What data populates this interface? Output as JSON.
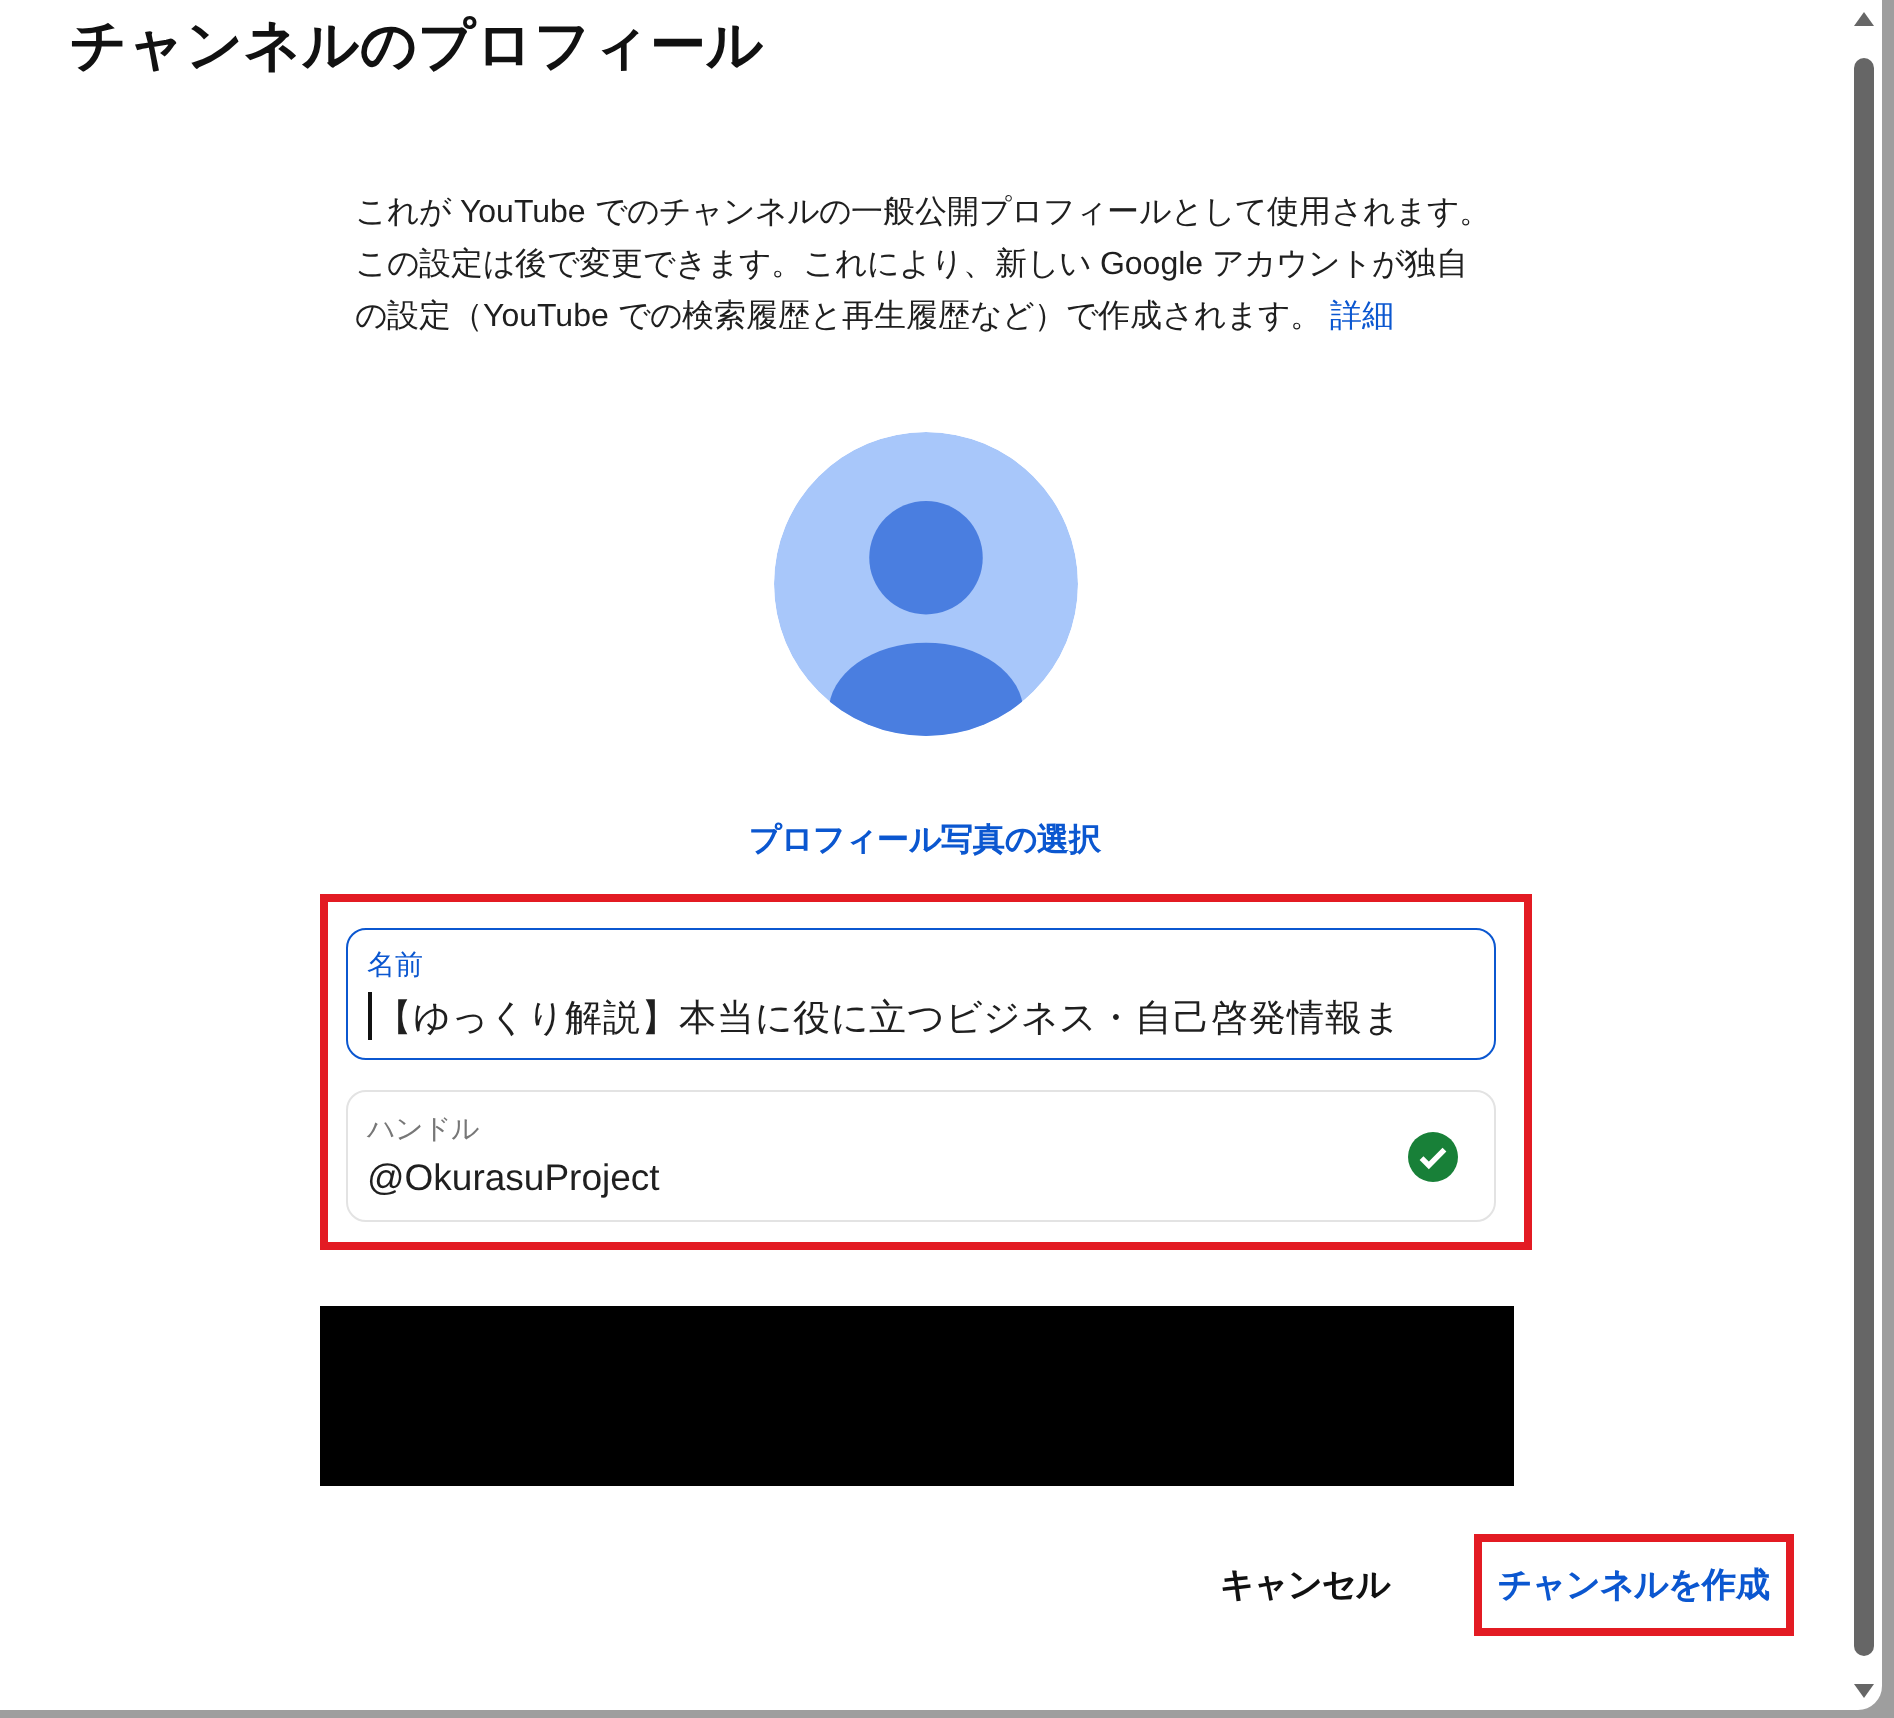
{
  "dialog": {
    "title": "チャンネルのプロフィール"
  },
  "description": {
    "text": "これが YouTube でのチャンネルの一般公開プロフィールとして使用されます。この設定は後で変更できます。これにより、新しい Google アカウントが独自の設定（YouTube での検索履歴と再生履歴など）で作成されます。",
    "link": "詳細"
  },
  "photo_link": "プロフィール写真の選択",
  "fields": [
    {
      "label": "名前",
      "value": "【ゆっくり解説】本当に役に立つビジネス・自己啓発情報ま",
      "focused": true,
      "verified": false
    },
    {
      "label": "ハンドル",
      "value": "@OkurasuProject",
      "focused": false,
      "verified": true
    }
  ],
  "buttons": [
    {
      "label": "キャンセル",
      "kind": "text"
    },
    {
      "label": "チャンネルを作成",
      "kind": "primary"
    }
  ]
}
